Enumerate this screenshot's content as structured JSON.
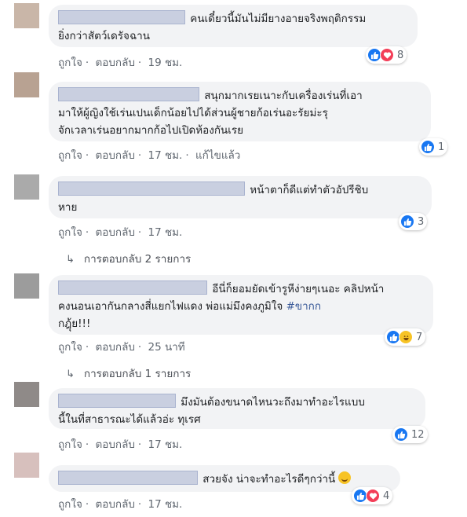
{
  "colors": {
    "bubble_bg": "#f2f3f5",
    "link_gray": "#606770",
    "like_blue": "#1877f2",
    "love_red": "#f33e58",
    "haha_yellow": "#f7c325",
    "hashtag": "#385898"
  },
  "actions": {
    "like": "ถูกใจ",
    "reply": "ตอบกลับ",
    "separator": "·"
  },
  "comments": [
    {
      "lines": [
        "คนเดี๋ยวนี้มันไม่มียางอายจริงพฤติกรรม",
        "ยิ่งกว่าสัตว์เดรัจฉาน"
      ],
      "time": "19 ชม.",
      "reactions": [
        "like-icon",
        "love-icon"
      ],
      "reaction_count": "8"
    },
    {
      "lines": [
        "สนุกมากเรยเนาะกับเครื่องเร่นที่เอา",
        "มาให้ผู้ญิงใช้เร่นเปนเด็กน้อยไปได้ส่วนผู้ชายก้อเร่นอะรัยม่ะรุ",
        "จักเวลาเร่นอยากมากก้อไปเปิดห้องกันเรย"
      ],
      "time": "17 ชม.",
      "edited": "แก้ไขแล้ว",
      "reactions": [
        "like-icon"
      ],
      "reaction_count": "1"
    },
    {
      "lines": [
        "หน้าตาก็ดีแต่ทำตัวอัปรีชิบ",
        "หาย"
      ],
      "time": "17 ชม.",
      "reactions": [
        "like-icon"
      ],
      "reaction_count": "3",
      "replies": "การตอบกลับ 2 รายการ"
    },
    {
      "lines": [
        "อีนี่ก็ยอมยัดเข้ารูหีง่ายๆเนอะ คลิปหน้า",
        "คงนอนเอากันกลางสี่แยกไฟแดง พ่อแม่มึงคงภูมิใจ",
        "กฎุ้ย!!!"
      ],
      "hashtag": "#ขากก",
      "time": "25 นาที",
      "reactions": [
        "like-icon",
        "haha-icon"
      ],
      "reaction_count": "7",
      "replies": "การตอบกลับ 1 รายการ"
    },
    {
      "lines": [
        "มึงมันต้องขนาดไหนวะถึงมาทำอะไรแบบ",
        "นี้ในที่สาธารณะได้แล้วอ่ะ ทุเรศ"
      ],
      "time": "17 ชม.",
      "reactions": [
        "like-icon"
      ],
      "reaction_count": "12"
    },
    {
      "lines": [
        "สวยจัง น่าจะทำอะไรดีๆกว่านี้"
      ],
      "emoji": "smiling-face-icon",
      "time": "17 ชม.",
      "reactions": [
        "like-icon",
        "love-icon"
      ],
      "reaction_count": "4"
    }
  ]
}
